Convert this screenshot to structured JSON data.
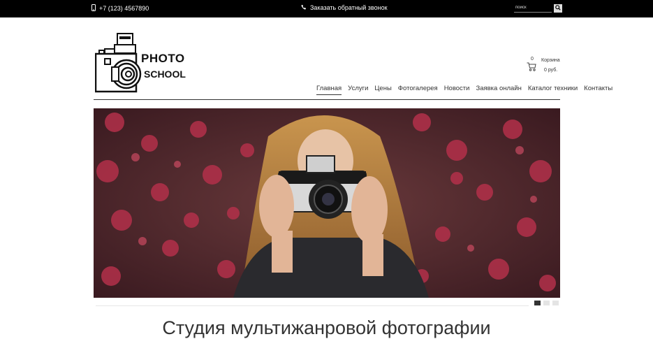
{
  "topbar": {
    "phone": "+7 (123) 4567890",
    "callback_label": "Заказать обратный звонок",
    "search_placeholder": "поиск"
  },
  "logo": {
    "line1": "PHOTO",
    "line2": "SCHOOL"
  },
  "cart": {
    "count": "0",
    "label": "Корзина",
    "price": "0 руб."
  },
  "nav": [
    {
      "label": "Главная",
      "active": true
    },
    {
      "label": "Услуги"
    },
    {
      "label": "Цены"
    },
    {
      "label": "Фотогалерея"
    },
    {
      "label": "Новости"
    },
    {
      "label": "Заявка онлайн"
    },
    {
      "label": "Каталог техники"
    },
    {
      "label": "Контакты"
    }
  ],
  "slider": {
    "total_slides": 3,
    "active_slide": 1
  },
  "main": {
    "title": "Студия мультижанровой фотографии"
  },
  "colors": {
    "topbar": "#000000",
    "accent": "#333333"
  }
}
